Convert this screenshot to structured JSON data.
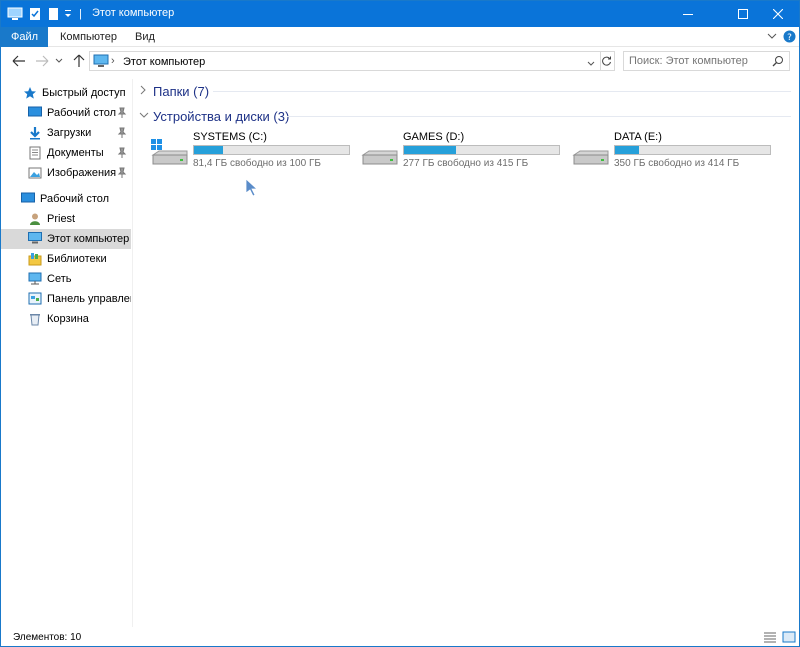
{
  "window": {
    "title": "Этот компьютер"
  },
  "ribbon": {
    "tabs": [
      "Файл",
      "Компьютер",
      "Вид"
    ]
  },
  "address": {
    "path": "Этот компьютер",
    "separator": "›"
  },
  "search": {
    "placeholder": "Поиск: Этот компьютер"
  },
  "sidebar": {
    "items": [
      {
        "label": "Быстрый доступ",
        "icon": "star-icon",
        "pinned": false
      },
      {
        "label": "Рабочий стол",
        "icon": "desktop-icon",
        "pinned": true
      },
      {
        "label": "Загрузки",
        "icon": "download-icon",
        "pinned": true
      },
      {
        "label": "Документы",
        "icon": "documents-icon",
        "pinned": true
      },
      {
        "label": "Изображения",
        "icon": "pictures-icon",
        "pinned": true
      },
      {
        "label": "Рабочий стол",
        "icon": "desktop-icon",
        "pinned": false
      },
      {
        "label": "Priest",
        "icon": "user-icon",
        "pinned": false
      },
      {
        "label": "Этот компьютер",
        "icon": "computer-icon",
        "pinned": false,
        "selected": true
      },
      {
        "label": "Библиотеки",
        "icon": "libraries-icon",
        "pinned": false
      },
      {
        "label": "Сеть",
        "icon": "network-icon",
        "pinned": false
      },
      {
        "label": "Панель управлени",
        "icon": "control-panel-icon",
        "pinned": false
      },
      {
        "label": "Корзина",
        "icon": "recycle-bin-icon",
        "pinned": false
      }
    ]
  },
  "content": {
    "groups": [
      {
        "label": "Папки (7)",
        "expanded": false
      },
      {
        "label": "Устройства и диски (3)",
        "expanded": true
      }
    ],
    "drives": [
      {
        "name": "SYSTEMS (C:)",
        "free_text": "81,4 ГБ свободно из 100 ГБ",
        "used_fraction": 0.186,
        "system": true
      },
      {
        "name": "GAMES (D:)",
        "free_text": "277 ГБ свободно из 415 ГБ",
        "used_fraction": 0.333,
        "system": false
      },
      {
        "name": "DATA (E:)",
        "free_text": "350 ГБ свободно из 414 ГБ",
        "used_fraction": 0.155,
        "system": false
      }
    ]
  },
  "statusbar": {
    "items_text": "Элементов: 10"
  },
  "colors": {
    "titlebar": "#0a74d9",
    "accent": "#1979ca",
    "drive_fill": "#26a0da",
    "group_header": "#1e3287"
  }
}
